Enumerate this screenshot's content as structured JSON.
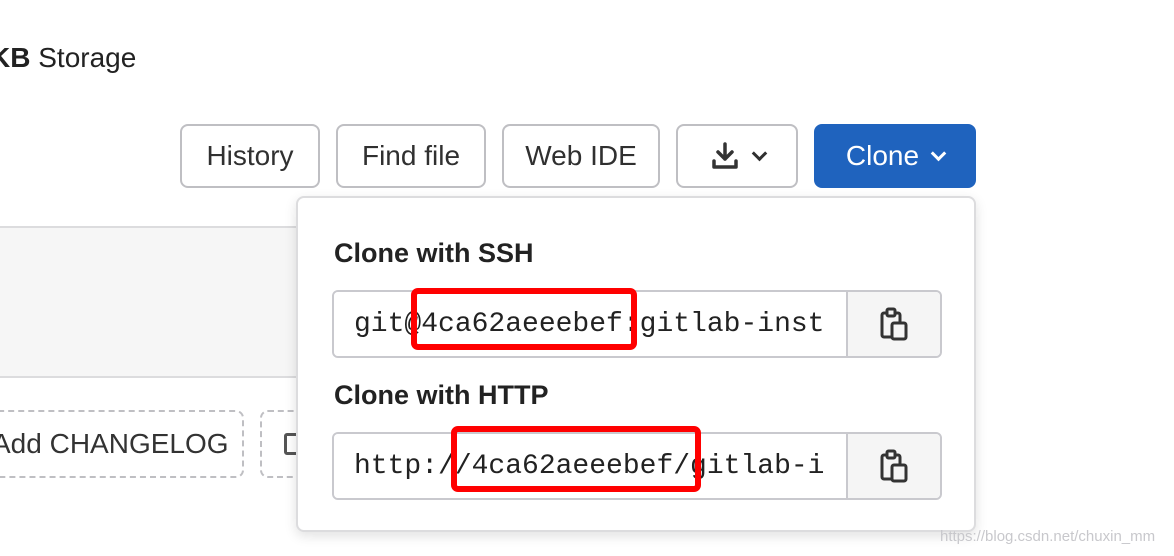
{
  "header": {
    "storage_prefix": "KB",
    "storage_label": "Storage"
  },
  "toolbar": {
    "history_label": "History",
    "find_file_label": "Find file",
    "web_ide_label": "Web IDE",
    "clone_label": "Clone"
  },
  "actions": {
    "add_changelog_label": "Add CHANGELOG"
  },
  "clone_dropdown": {
    "ssh_title": "Clone with SSH",
    "ssh_url": "git@4ca62aeeebef:gitlab-inst",
    "http_title": "Clone with HTTP",
    "http_url": "http://4ca62aeeebef/gitlab-i"
  },
  "watermark": "https://blog.csdn.net/chuxin_mm",
  "colors": {
    "primary": "#1f63be",
    "highlight": "#ff0000"
  }
}
